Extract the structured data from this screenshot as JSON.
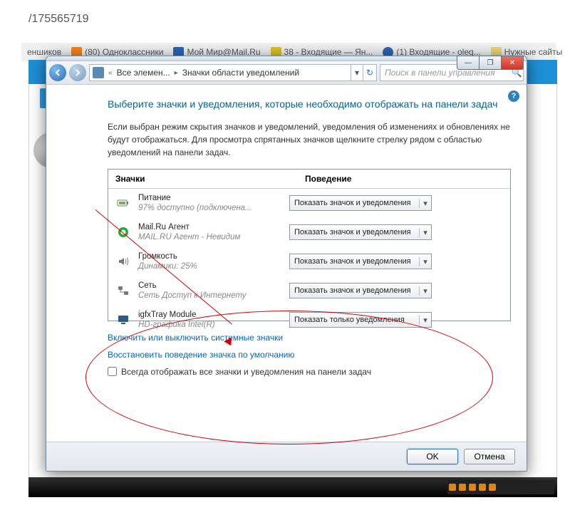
{
  "url_fragment": "/175565719",
  "browser_tabs": [
    {
      "label": "еншиков"
    },
    {
      "label": "(80) Одноклассники",
      "icon_color": "#f58220"
    },
    {
      "label": "Мой Мир@Mail.Ru",
      "icon_color": "#2a65b4"
    },
    {
      "label": "38 - Входящие — Ян...",
      "icon_color": "#d8c12a"
    },
    {
      "label": "(1) Входящие - oleg...",
      "icon_color": "#2a65b4"
    },
    {
      "label": "Нужные сайты",
      "icon_color": "#5aa055"
    }
  ],
  "window": {
    "controls": {
      "min": "—",
      "max": "❐",
      "close": "✕"
    },
    "breadcrumb": {
      "segments": [
        "Все элемен...",
        "Значки области уведомлений"
      ]
    },
    "search_placeholder": "Поиск в панели управления",
    "help": "?",
    "heading": "Выберите значки и уведомления, которые необходимо отображать на панели задач",
    "description": "Если выбран режим скрытия значков и уведомлений, уведомления об изменениях и обновлениях не будут отображаться. Для просмотра спрятанных значков щелкните стрелку рядом с областью уведомлений на панели задач.",
    "columns": {
      "icons": "Значки",
      "behavior": "Поведение"
    },
    "rows": [
      {
        "title": "Питание",
        "sub": "97% доступно (подключена...",
        "option": "Показать значок и уведомления"
      },
      {
        "title": "Mail.Ru Агент",
        "sub": "MAIL.RU Агент - Невидим",
        "option": "Показать значок и уведомления"
      },
      {
        "title": "Громкость",
        "sub": "Динамики: 25%",
        "option": "Показать значок и уведомления"
      },
      {
        "title": "Сеть",
        "sub": "Сеть Доступ к Интернету",
        "option": "Показать значок и уведомления"
      },
      {
        "title": "igfxTray Module",
        "sub": "HD-графика Intel(R)",
        "option": "Показать только уведомления"
      }
    ],
    "link1": "Включить или выключить системные значки",
    "link2": "Восстановить поведение значка по умолчанию",
    "checkbox_label": "Всегда отображать все значки и уведомления на панели задач",
    "ok": "OK",
    "cancel": "Отмена"
  }
}
